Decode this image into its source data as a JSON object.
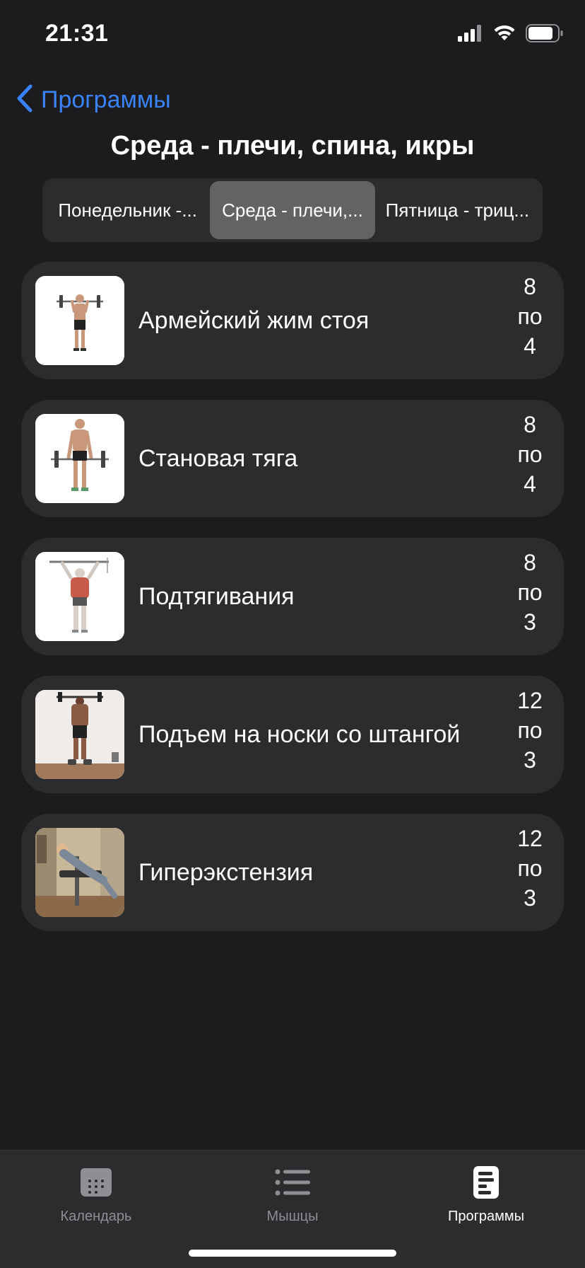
{
  "status_bar": {
    "time": "21:31"
  },
  "nav": {
    "back_label": "Программы",
    "title": "Среда - плечи, спина, икры"
  },
  "segments": [
    {
      "label": "Понедельник -..."
    },
    {
      "label": "Среда - плечи,...",
      "selected": true
    },
    {
      "label": "Пятница - триц..."
    }
  ],
  "exercises": [
    {
      "name": "Армейский жим стоя",
      "reps": "8",
      "sep": "по",
      "sets": "4",
      "image": "overhead-press-figure"
    },
    {
      "name": "Становая тяга",
      "reps": "8",
      "sep": "по",
      "sets": "4",
      "image": "deadlift-figure"
    },
    {
      "name": "Подтягивания",
      "reps": "8",
      "sep": "по",
      "sets": "3",
      "image": "pullup-figure"
    },
    {
      "name": "Подъем на носки со штангой",
      "reps": "12",
      "sep": "по",
      "sets": "3",
      "image": "calf-raise-photo"
    },
    {
      "name": "Гиперэкстензия",
      "reps": "12",
      "sep": "по",
      "sets": "3",
      "image": "hyperextension-photo"
    }
  ],
  "tabs": [
    {
      "label": "Календарь",
      "icon": "calendar-icon"
    },
    {
      "label": "Мышцы",
      "icon": "list-icon"
    },
    {
      "label": "Программы",
      "icon": "programs-icon",
      "active": true
    }
  ],
  "colors": {
    "background": "#1c1c1e",
    "card": "#2c2c2e",
    "accent": "#3a82f7",
    "segment_active": "#636366",
    "tab_inactive": "#8e8e93"
  }
}
